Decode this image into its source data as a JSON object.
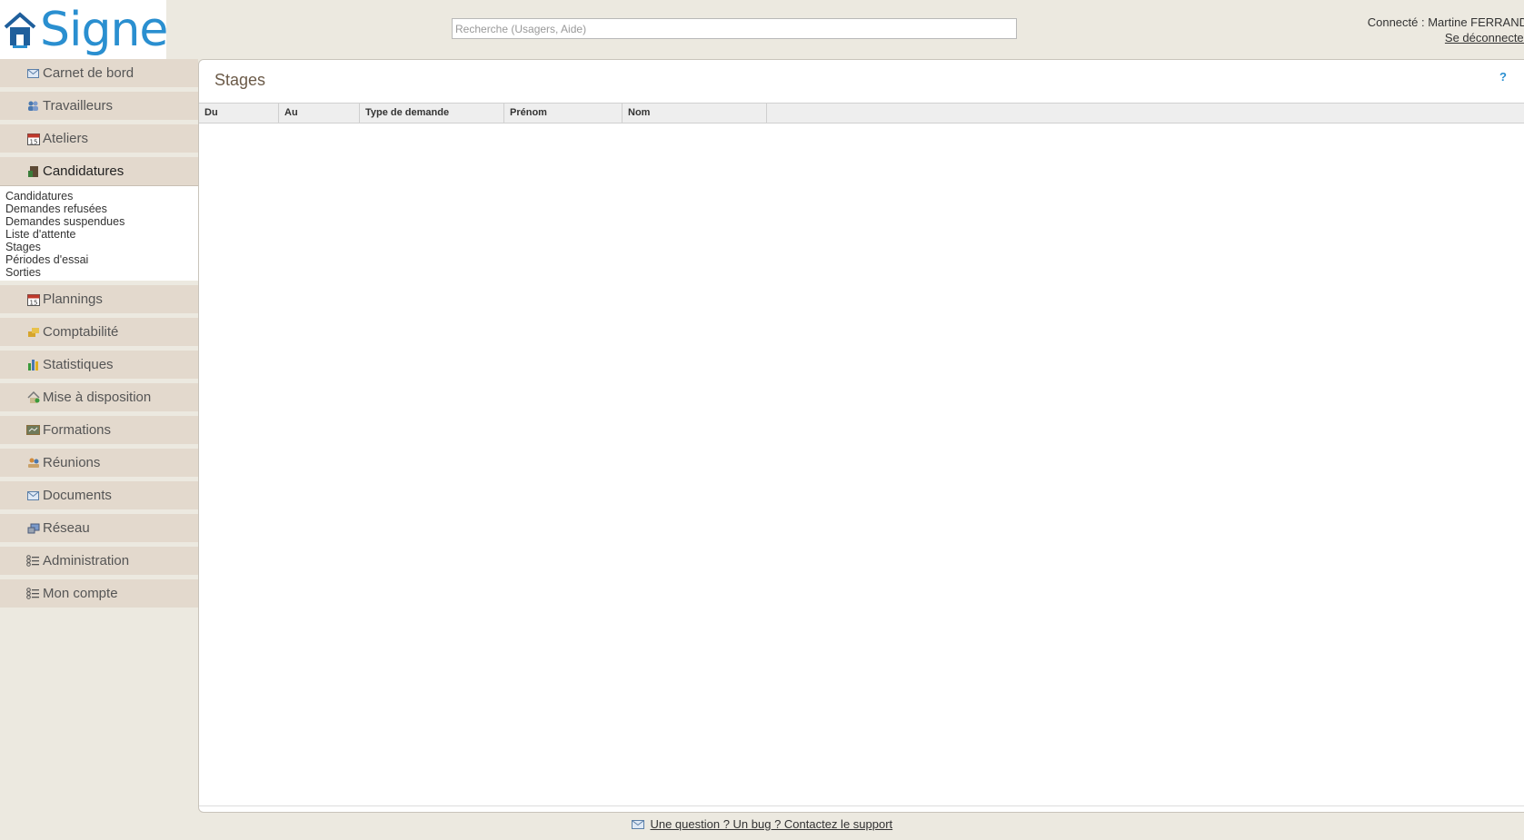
{
  "header": {
    "logo_text": "Signe",
    "search_placeholder": "Recherche (Usagers, Aide)",
    "connected_label": "Connecté : Martine FERRAND",
    "logout_label": "Se déconnecter"
  },
  "sidebar": {
    "items": [
      {
        "label": "Carnet de bord",
        "icon": "envelope-icon"
      },
      {
        "label": "Travailleurs",
        "icon": "users-icon"
      },
      {
        "label": "Ateliers",
        "icon": "calendar-icon"
      },
      {
        "label": "Candidatures",
        "icon": "door-icon"
      },
      {
        "label": "Plannings",
        "icon": "calendar-icon"
      },
      {
        "label": "Comptabilité",
        "icon": "coins-icon"
      },
      {
        "label": "Statistiques",
        "icon": "bar-chart-icon"
      },
      {
        "label": "Mise à disposition",
        "icon": "house-icon"
      },
      {
        "label": "Formations",
        "icon": "board-icon"
      },
      {
        "label": "Réunions",
        "icon": "meeting-icon"
      },
      {
        "label": "Documents",
        "icon": "envelope-icon"
      },
      {
        "label": "Réseau",
        "icon": "network-icon"
      },
      {
        "label": "Administration",
        "icon": "list-icon"
      },
      {
        "label": "Mon compte",
        "icon": "list-icon"
      }
    ],
    "submenu": [
      "Candidatures",
      "Demandes refusées",
      "Demandes suspendues",
      "Liste d'attente",
      "Stages",
      "Périodes d'essai",
      "Sorties"
    ]
  },
  "main": {
    "title": "Stages",
    "help_label": "?",
    "columns": [
      "Du",
      "Au",
      "Type de demande",
      "Prénom",
      "Nom"
    ]
  },
  "footer": {
    "support_link": "Une question ? Un bug ? Contactez le support"
  },
  "colors": {
    "background": "#ece9e0",
    "menu_item": "#e3d9cd",
    "accent": "#2a8fd0",
    "title": "#6b5a48"
  }
}
